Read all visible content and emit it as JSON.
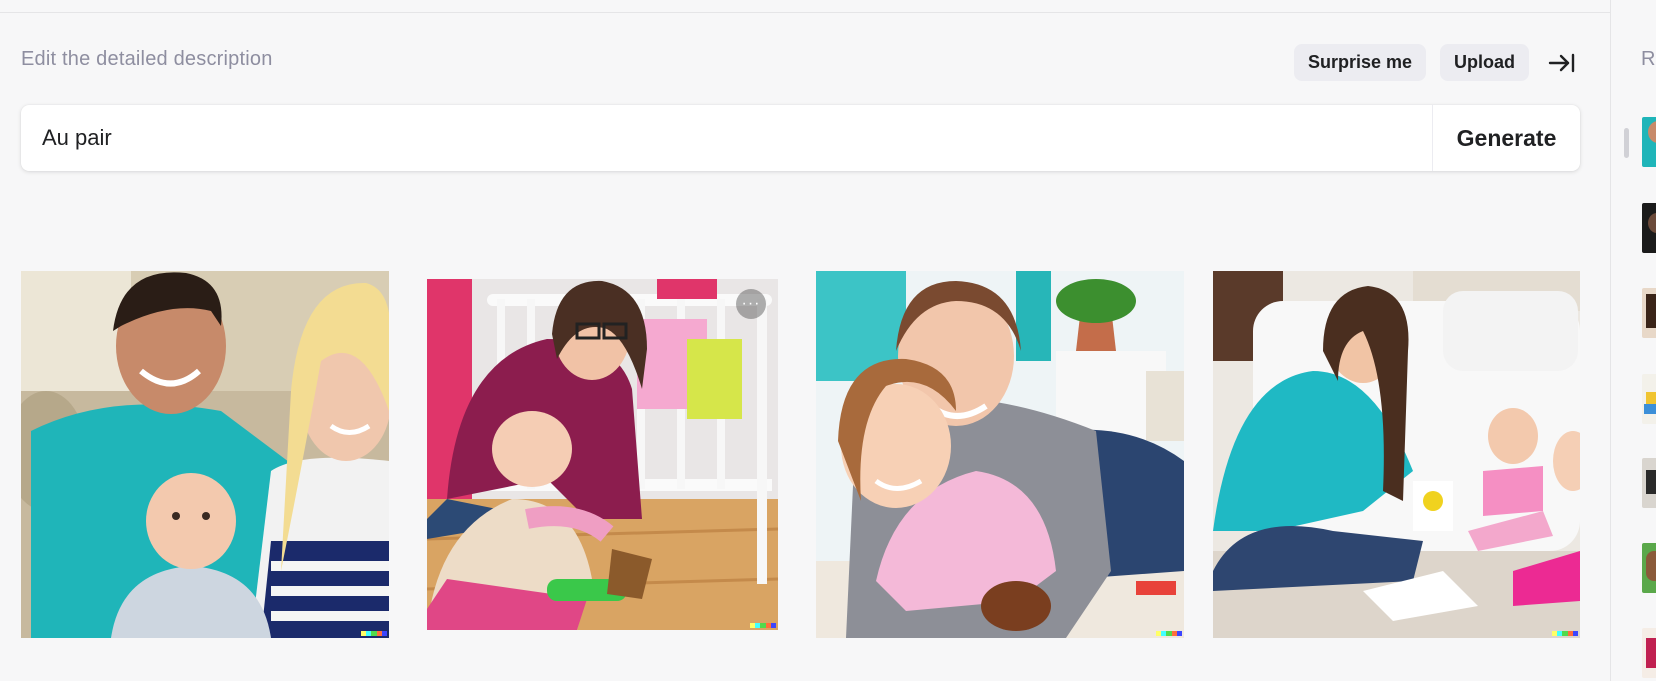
{
  "editor": {
    "heading": "Edit the detailed description",
    "surprise_label": "Surprise me",
    "upload_label": "Upload",
    "prompt_value": "Au pair",
    "generate_label": "Generate",
    "collapse_icon": "arrow-to-right-icon"
  },
  "gallery": {
    "images": [
      {
        "alt": "Young man and woman smiling with a baby",
        "icon": "image"
      },
      {
        "alt": "Woman playing with a baby next to a crib",
        "icon": "image"
      },
      {
        "alt": "Woman hugging a smiling girl on a rug",
        "icon": "image"
      },
      {
        "alt": "Woman in teal drawing with two toddlers",
        "icon": "image"
      }
    ],
    "more_icon": "more-options-icon"
  },
  "sidebar": {
    "title": "R",
    "thumbnail_count": 7
  },
  "colors": {
    "background": "#f7f7f8",
    "muted_text": "#8e8ea0",
    "pill_bg": "#ececf1",
    "signature": [
      "#ffff66",
      "#42ffff",
      "#51da4c",
      "#ff6e3c",
      "#3c46ff"
    ]
  }
}
